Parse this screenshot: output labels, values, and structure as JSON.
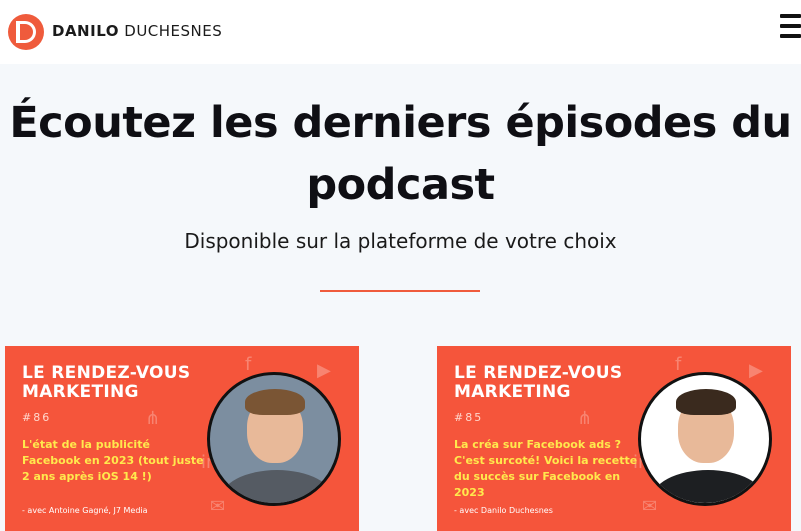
{
  "header": {
    "brand_bold": "DANILO",
    "brand_light": "DUCHESNES",
    "logo_icon": "logo-dd-icon",
    "menu_icon": "hamburger-icon"
  },
  "hero": {
    "title": "Écoutez les derniers épisodes du podcast",
    "subtitle": "Disponible sur la plateforme de votre choix"
  },
  "colors": {
    "accent": "#ef5b3c",
    "card_bg": "#f5553b",
    "episode_title": "#ffe94d"
  },
  "episodes": [
    {
      "show": "LE RENDEZ-VOUS MARKETING",
      "number": "#86",
      "title": "L'état de la publicité Facebook en 2023 (tout juste 2 ans après iOS 14 !)",
      "guest": "- avec Antoine Gagné, J7 Media"
    },
    {
      "show": "LE RENDEZ-VOUS MARKETING",
      "number": "#85",
      "title": "La créa sur Facebook ads ? C'est surcoté! Voici la recette du succès sur Facebook en 2023",
      "guest": "- avec Danilo Duchesnes"
    }
  ]
}
